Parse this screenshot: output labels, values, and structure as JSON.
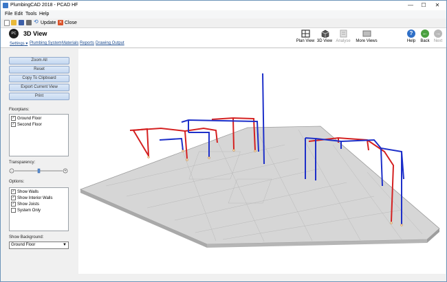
{
  "window": {
    "title": "PlumbingCAD 2018 - PCAD HF",
    "minimize": "—",
    "maximize": "☐",
    "close": "✕"
  },
  "menu": [
    "File",
    "Edit",
    "Tools",
    "Help"
  ],
  "toolbar": {
    "update_label": "Update",
    "close_label": "Close"
  },
  "ribbon": {
    "title": "3D View",
    "links": [
      "Settings",
      "Plumbing System",
      "Materials",
      "Reports",
      "Drawing Output"
    ],
    "buttons": [
      {
        "label": "Plan View",
        "icon": "plan-view-icon",
        "enabled": true
      },
      {
        "label": "3D View",
        "icon": "3d-view-icon",
        "enabled": true
      },
      {
        "label": "Analyse",
        "icon": "analyse-icon",
        "enabled": false
      },
      {
        "label": "More Views",
        "icon": "more-views-icon",
        "enabled": true
      }
    ],
    "nav": [
      {
        "label": "Help",
        "icon": "help-icon",
        "symbol": "?",
        "color": "#2f6fc7",
        "enabled": true
      },
      {
        "label": "Back",
        "icon": "back-arrow-icon",
        "symbol": "←",
        "color": "#4aa040",
        "enabled": true
      },
      {
        "label": "Next",
        "icon": "next-arrow-icon",
        "symbol": "→",
        "color": "#b9b9b9",
        "enabled": false
      }
    ]
  },
  "left_panel": {
    "buttons": [
      "Zoom All",
      "Reset",
      "Copy To Clipboard",
      "Export Current View",
      "Print"
    ],
    "floorplans_label": "Floorplans:",
    "floorplans": [
      {
        "label": "Ground Floor",
        "checked": true
      },
      {
        "label": "Second Floor",
        "checked": true
      }
    ],
    "transparency_label": "Transparency:",
    "transparency": 0.5,
    "options_label": "Options:",
    "options": [
      {
        "label": "Show Walls",
        "checked": true
      },
      {
        "label": "Show Interior Walls",
        "checked": true
      },
      {
        "label": "Show Joists",
        "checked": true
      },
      {
        "label": "System Only",
        "checked": false
      }
    ],
    "background_label": "Show Background:",
    "background_value": "Ground Floor"
  },
  "colors": {
    "hot_pipe": "#d42020",
    "cold_pipe": "#1d2fc9",
    "floor": "#cfcfcf",
    "accent": "#2f6fc7"
  }
}
